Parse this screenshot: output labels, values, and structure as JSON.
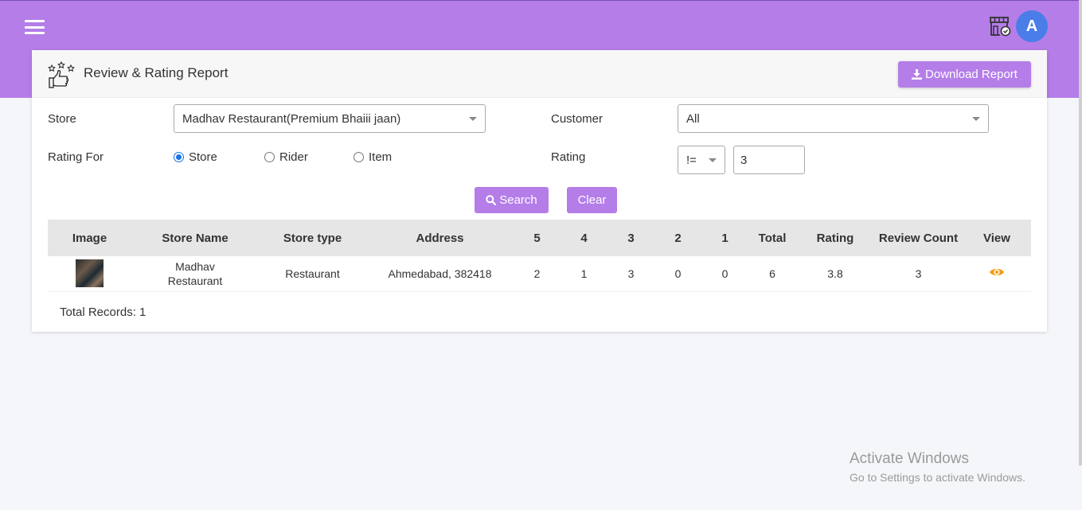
{
  "header": {
    "avatar_initial": "A"
  },
  "report": {
    "title": "Review & Rating Report",
    "download_label": "Download Report"
  },
  "filters": {
    "store_label": "Store",
    "store_value": "Madhav Restaurant(Premium Bhaiii jaan)",
    "customer_label": "Customer",
    "customer_value": "All",
    "rating_for_label": "Rating For",
    "rating_for_options": [
      "Store",
      "Rider",
      "Item"
    ],
    "rating_for_selected": "Store",
    "rating_label": "Rating",
    "rating_operator": "!=",
    "rating_value": "3",
    "search_label": "Search",
    "clear_label": "Clear"
  },
  "table": {
    "columns": [
      "Image",
      "Store Name",
      "Store type",
      "Address",
      "5",
      "4",
      "3",
      "2",
      "1",
      "Total",
      "Rating",
      "Review Count",
      "View"
    ],
    "rows": [
      {
        "store_name": "Madhav Restaurant",
        "store_type": "Restaurant",
        "address": "Ahmedabad, 382418",
        "r5": "2",
        "r4": "1",
        "r3": "3",
        "r2": "0",
        "r1": "0",
        "total": "6",
        "rating": "3.8",
        "review_count": "3"
      }
    ]
  },
  "total_records": "Total Records: 1",
  "watermark": {
    "line1": "Activate Windows",
    "line2": "Go to Settings to activate Windows."
  },
  "colors": {
    "accent": "#b47de8",
    "avatar": "#4a7de8",
    "eye": "#f39c12"
  }
}
